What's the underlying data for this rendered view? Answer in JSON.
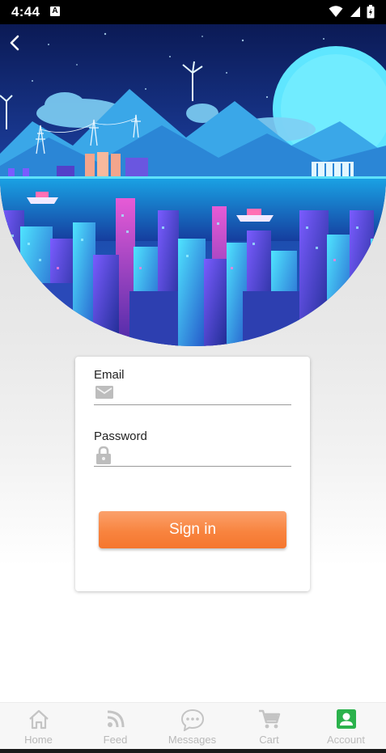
{
  "status_bar": {
    "time": "4:44",
    "notification_badge": "A"
  },
  "login": {
    "email_label": "Email",
    "email_value": "",
    "password_label": "Password",
    "password_value": "",
    "sign_in_label": "Sign in"
  },
  "nav": {
    "items": [
      {
        "label": "Home",
        "icon": "home-icon"
      },
      {
        "label": "Feed",
        "icon": "rss-icon"
      },
      {
        "label": "Messages",
        "icon": "chat-icon"
      },
      {
        "label": "Cart",
        "icon": "cart-icon"
      },
      {
        "label": "Account",
        "icon": "account-icon",
        "active": true
      }
    ]
  },
  "colors": {
    "accent_orange": "#f8843f",
    "active_nav": "#2bb24c",
    "inactive_nav": "#b9b9b9"
  }
}
